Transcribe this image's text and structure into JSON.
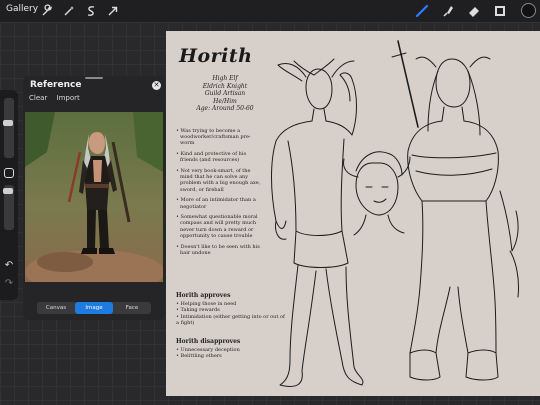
{
  "topbar": {
    "gallery_label": "Gallery",
    "left_tools": [
      "wrench-icon",
      "magic-wand-icon",
      "selection-s-icon",
      "transform-arrow-icon"
    ],
    "right_tools": [
      "brush-icon",
      "smudge-icon",
      "eraser-icon",
      "layers-icon"
    ],
    "accent_color": "#2f7bff",
    "current_color": "#111111"
  },
  "reference": {
    "title": "Reference",
    "clear_label": "Clear",
    "import_label": "Import",
    "tabs": [
      {
        "label": "Canvas",
        "active": false
      },
      {
        "label": "Image",
        "active": true
      },
      {
        "label": "Face",
        "active": false
      }
    ],
    "active_color": "#1e7be0"
  },
  "sheet": {
    "name": "Horith",
    "info_lines": [
      "High Elf",
      "Eldrich Knight",
      "Guild Artisan",
      "He/Him",
      "Age: Around 50-60"
    ],
    "notes": [
      "• Was trying to become a woodworker/craftsman pre-worm",
      "• Kind and protective of his friends (and resources)",
      "• Not very book-smart, of the mind that he can solve any problem with a big enough axe, sword, or fireball",
      "• More of an intimidator than a negotiator",
      "• Somewhat questionable moral compass and will pretty much never turn down a reward or opportunity to cause trouble",
      "• Doesn't like to be seen with his hair undone"
    ],
    "approves_title": "Horith approves",
    "approves": [
      "• Helping those in need",
      "• Taking rewards",
      "• Intimidation (either getting into or out of a fight)"
    ],
    "disapproves_title": "Horith disapproves",
    "disapproves": [
      "• Unnecessary deception",
      "• Belittling others"
    ]
  }
}
